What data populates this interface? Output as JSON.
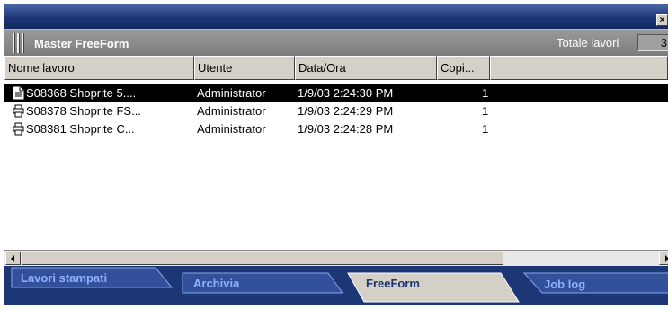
{
  "window": {
    "close_label": "×"
  },
  "header": {
    "title": "Master FreeForm",
    "totale_label": "Totale lavori",
    "totale_value": "3"
  },
  "columns": [
    {
      "label": "Nome lavoro"
    },
    {
      "label": "Utente"
    },
    {
      "label": "Data/Ora"
    },
    {
      "label": "Copi..."
    },
    {
      "label": ""
    }
  ],
  "rows": [
    {
      "icon": "document-icon",
      "name": "S08368 Shoprite 5....",
      "user": "Administrator",
      "datetime": "1/9/03 2:24:30 PM",
      "copies": "1",
      "selected": true
    },
    {
      "icon": "printer-icon",
      "name": "S08378 Shoprite FS...",
      "user": "Administrator",
      "datetime": "1/9/03 2:24:29 PM",
      "copies": "1",
      "selected": false
    },
    {
      "icon": "printer-icon",
      "name": "S08381 Shoprite C...",
      "user": "Administrator",
      "datetime": "1/9/03 2:24:28 PM",
      "copies": "1",
      "selected": false
    }
  ],
  "tabs": [
    {
      "label": "Lavori stampati",
      "active": false
    },
    {
      "label": "Archivia",
      "active": false
    },
    {
      "label": "FreeForm",
      "active": true
    },
    {
      "label": "Job log",
      "active": false
    }
  ],
  "colors": {
    "titlebar": "#1c3472",
    "header": "#8a8a8a",
    "tab_active": "#d4d0c8",
    "tab_inactive": "#33519b",
    "tab_text_inactive": "#7fa0ff",
    "selection": "#000000"
  }
}
